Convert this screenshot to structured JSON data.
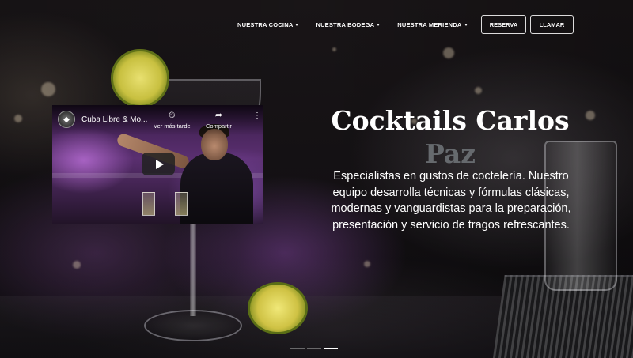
{
  "nav": {
    "items": [
      {
        "label": "NUESTRA COCINA",
        "has_dropdown": true
      },
      {
        "label": "NUESTRA BODEGA",
        "has_dropdown": true
      },
      {
        "label": "NUESTRA MERIENDA",
        "has_dropdown": true
      }
    ],
    "reserva_label": "RESERVA",
    "llamar_label": "LLAMAR"
  },
  "video": {
    "title": "Cuba Libre & Mo...",
    "watch_later_label": "Ver más tarde",
    "share_label": "Compartir",
    "icons": {
      "watch_later": "clock-icon",
      "share": "share-icon",
      "menu": "more-vertical-icon",
      "play": "play-icon"
    }
  },
  "hero": {
    "title_line1": "Cocktails Carlos",
    "title_line2": "Paz",
    "description": "Especialistas en gustos de coctelería. Nuestro equipo desarrolla técnicas y fórmulas clásicas, modernas y vanguardistas para la preparación, presentación y servicio de tragos refrescantes."
  },
  "carousel": {
    "slide_count": 3,
    "active_index": 2
  },
  "colors": {
    "text": "#ffffff",
    "subtitle": "#666a6e",
    "background": "#141114"
  }
}
